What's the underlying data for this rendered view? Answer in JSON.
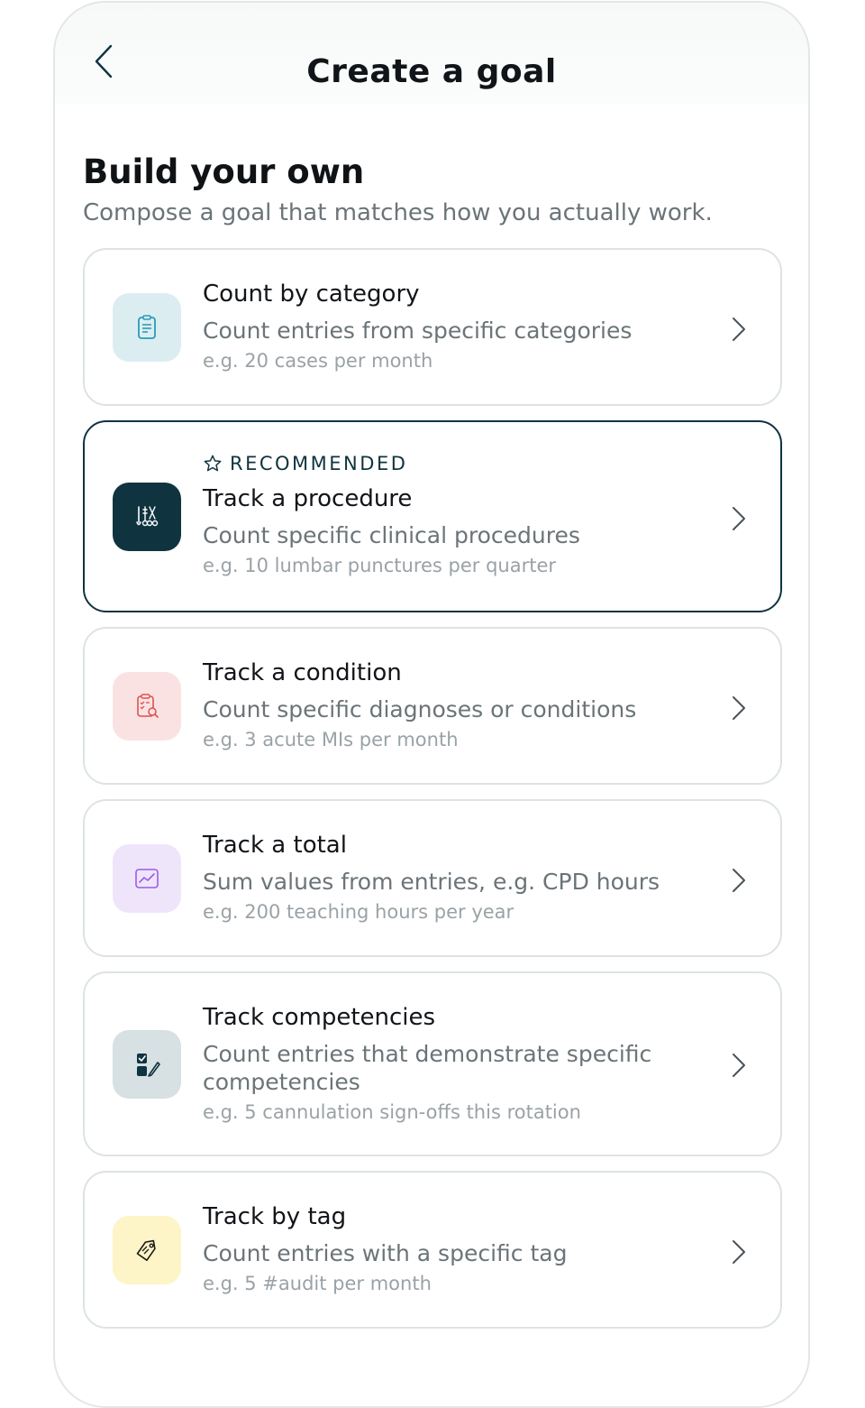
{
  "header": {
    "title": "Create a goal"
  },
  "section": {
    "title": "Build your own",
    "subtitle": "Compose a goal that matches how you actually work."
  },
  "recommended_label": "RECOMMENDED",
  "cards": [
    {
      "title": "Count by category",
      "description": "Count entries from specific categories",
      "example": "e.g. 20 cases per month",
      "icon": "clipboard-list-icon",
      "icon_bg": "#dcedf1",
      "icon_color": "#2a9bb8"
    },
    {
      "title": "Track a procedure",
      "description": "Count specific clinical procedures",
      "example": "e.g. 10 lumbar punctures per quarter",
      "icon": "surgical-tools-icon",
      "icon_bg": "#0f3440",
      "icon_color": "#ffffff",
      "recommended": true
    },
    {
      "title": "Track a condition",
      "description": "Count specific diagnoses or conditions",
      "example": "e.g. 3 acute MIs per month",
      "icon": "clipboard-search-icon",
      "icon_bg": "#fbe2e2",
      "icon_color": "#d9534f"
    },
    {
      "title": "Track a total",
      "description": "Sum values from entries, e.g. CPD hours",
      "example": "e.g. 200 teaching hours per year",
      "icon": "line-chart-icon",
      "icon_bg": "#efe5fb",
      "icon_color": "#9b5de5"
    },
    {
      "title": "Track competencies",
      "description": "Count entries that demonstrate specific competencies",
      "example": "e.g. 5 cannulation sign-offs this rotation",
      "icon": "checklist-edit-icon",
      "icon_bg": "#d7e0e3",
      "icon_color": "#0f3440"
    },
    {
      "title": "Track by tag",
      "description": "Count entries with a specific tag",
      "example": "e.g. 5 #audit per month",
      "icon": "tag-icon",
      "icon_bg": "#fdf4c7",
      "icon_color": "#1a1a1a"
    }
  ]
}
